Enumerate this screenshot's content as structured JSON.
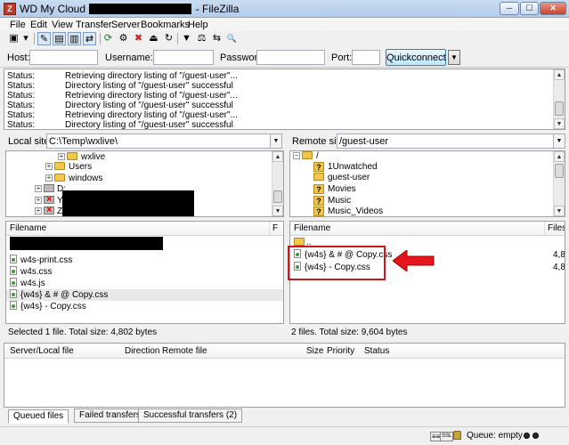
{
  "window": {
    "title_prefix": "WD My Cloud",
    "title_suffix": "- FileZilla",
    "app_icon": "filezilla-icon",
    "minimize": "─",
    "maximize": "☐",
    "close": "✕"
  },
  "menu": [
    "File",
    "Edit",
    "View",
    "Transfer",
    "Server",
    "Bookmarks",
    "Help"
  ],
  "toolbar": {
    "icons": [
      "site-manager-icon",
      "dropdown-icon",
      "toggle-log-icon",
      "toggle-local-tree-icon",
      "toggle-remote-tree-icon",
      "toggle-queue-icon",
      "refresh-icon",
      "process-queue-icon",
      "cancel-icon",
      "disconnect-icon",
      "reconnect-icon",
      "filter-icon",
      "compare-icon",
      "sync-browse-icon",
      "search-icon"
    ],
    "glyphs": [
      "▣",
      "▾",
      "✎",
      "▤",
      "▥",
      "⇄",
      "⟳",
      "⚙",
      "✖",
      "⏏",
      "↻",
      "▼",
      "⚖",
      "⇆",
      "🔍"
    ]
  },
  "quickconnect": {
    "host_label": "Host:",
    "host_value": "",
    "username_label": "Username:",
    "username_value": "",
    "password_label": "Password:",
    "password_value": "",
    "port_label": "Port:",
    "port_value": "",
    "button": "Quickconnect",
    "dropdown": "▼"
  },
  "log": [
    {
      "label": "Status:",
      "text": "Retrieving directory listing of \"/guest-user\"..."
    },
    {
      "label": "Status:",
      "text": "Directory listing of \"/guest-user\" successful"
    },
    {
      "label": "Status:",
      "text": "Retrieving directory listing of \"/guest-user\"..."
    },
    {
      "label": "Status:",
      "text": "Directory listing of \"/guest-user\" successful"
    },
    {
      "label": "Status:",
      "text": "Retrieving directory listing of \"/guest-user\"..."
    },
    {
      "label": "Status:",
      "text": "Directory listing of \"/guest-user\" successful"
    }
  ],
  "local": {
    "site_label": "Local site:",
    "path": "C:\\Temp\\wxlive\\",
    "tree": [
      {
        "label": "wxlive",
        "expander": "+"
      },
      {
        "label": "Users",
        "expander": "+"
      },
      {
        "label": "windows",
        "expander": "+"
      },
      {
        "label": "D:",
        "expander": "+"
      },
      {
        "label": "Y:",
        "expander": "+"
      },
      {
        "label": "Z:",
        "expander": "+"
      }
    ],
    "header": {
      "filename": "Filename",
      "size": "F"
    },
    "files": [
      {
        "name": ""
      },
      {
        "name": "w4s-print.css"
      },
      {
        "name": "w4s.css"
      },
      {
        "name": "w4s.js"
      },
      {
        "name": "{w4s} & # @ Copy.css"
      },
      {
        "name": "{w4s} - Copy.css"
      }
    ],
    "status": "Selected 1 file. Total size: 4,802 bytes"
  },
  "remote": {
    "site_label": "Remote site:",
    "path": "/guest-user",
    "tree": [
      {
        "label": "/",
        "expander": "−",
        "icon": "folder"
      },
      {
        "label": "1Unwatched",
        "icon": "qfolder"
      },
      {
        "label": "guest-user",
        "icon": "folder"
      },
      {
        "label": "Movies",
        "icon": "qfolder"
      },
      {
        "label": "Music",
        "icon": "qfolder"
      },
      {
        "label": "Music_Videos",
        "icon": "qfolder"
      }
    ],
    "header": {
      "filename": "Filename",
      "size": "Filesi"
    },
    "files": [
      {
        "name": "..",
        "size": ""
      },
      {
        "name": "{w4s} & # @ Copy.css",
        "size": "4,8"
      },
      {
        "name": "{w4s} - Copy.css",
        "size": "4,8"
      }
    ],
    "status": "2 files. Total size: 9,604 bytes"
  },
  "queue": {
    "columns": [
      "Server/Local file",
      "Direction",
      "Remote file",
      "Size",
      "Priority",
      "Status"
    ]
  },
  "tabs": [
    "Queued files",
    "Failed transfers",
    "Successful transfers (2)"
  ],
  "statusbar": {
    "queue": "Queue: empty",
    "icon1": "≡≡",
    "icon2": "SSL"
  },
  "colors": {
    "highlight": "#d0141b",
    "redaction": "#000000"
  }
}
